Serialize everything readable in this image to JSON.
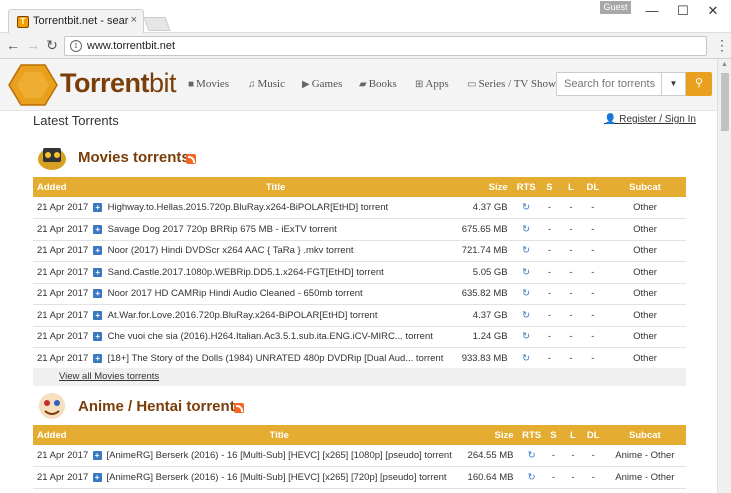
{
  "browser": {
    "tab_title": "Torrentbit.net - search to",
    "tab_close": "×",
    "guest_label": "Guest",
    "minimize": "—",
    "maximize": "☐",
    "close": "✕",
    "url": "www.torrentbit.net"
  },
  "site": {
    "logo_main": "Torrent",
    "logo_bit": "bit",
    "menu": [
      {
        "label": "Movies",
        "icon": "film-icon"
      },
      {
        "label": "Music",
        "icon": "music-icon"
      },
      {
        "label": "Games",
        "icon": "play-icon"
      },
      {
        "label": "Books",
        "icon": "book-icon"
      },
      {
        "label": "Apps",
        "icon": "windows-icon"
      },
      {
        "label": "Series / TV Shows",
        "icon": "tv-icon"
      }
    ],
    "search_placeholder": "Search for torrents",
    "latest": "Latest Torrents",
    "register": "Register / Sign In"
  },
  "columns": [
    "Added",
    "Title",
    "Size",
    "RTS",
    "S",
    "L",
    "DL",
    "Subcat"
  ],
  "movies": {
    "title": "Movies torrents",
    "view_all": "View all Movies torrents",
    "rows": [
      {
        "added": "21 Apr 2017",
        "title": "Highway.to.Hellas.2015.720p.BluRay.x264-BiPOLAR[EtHD] torrent",
        "size": "4.37 GB",
        "s": "-",
        "l": "-",
        "dl": "-",
        "subcat": "Other"
      },
      {
        "added": "21 Apr 2017",
        "title": "Savage Dog 2017 720p BRRip 675 MB - iExTV torrent",
        "size": "675.65 MB",
        "s": "-",
        "l": "-",
        "dl": "-",
        "subcat": "Other"
      },
      {
        "added": "21 Apr 2017",
        "title": "Noor (2017) Hindi DVDScr x264 AAC { TaRa } .mkv torrent",
        "size": "721.74 MB",
        "s": "-",
        "l": "-",
        "dl": "-",
        "subcat": "Other"
      },
      {
        "added": "21 Apr 2017",
        "title": "Sand.Castle.2017.1080p.WEBRip.DD5.1.x264-FGT[EtHD] torrent",
        "size": "5.05 GB",
        "s": "-",
        "l": "-",
        "dl": "-",
        "subcat": "Other"
      },
      {
        "added": "21 Apr 2017",
        "title": "Noor 2017 HD CAMRip Hindi Audio Cleaned - 650mb torrent",
        "size": "635.82 MB",
        "s": "-",
        "l": "-",
        "dl": "-",
        "subcat": "Other"
      },
      {
        "added": "21 Apr 2017",
        "title": "At.War.for.Love.2016.720p.BluRay.x264-BiPOLAR[EtHD] torrent",
        "size": "4.37 GB",
        "s": "-",
        "l": "-",
        "dl": "-",
        "subcat": "Other"
      },
      {
        "added": "21 Apr 2017",
        "title": "Che vuoi che sia (2016).H264.Italian.Ac3.5.1.sub.ita.ENG.iCV-MIRC... torrent",
        "size": "1.24 GB",
        "s": "-",
        "l": "-",
        "dl": "-",
        "subcat": "Other"
      },
      {
        "added": "21 Apr 2017",
        "title": "[18+] The Story of the Dolls (1984) UNRATED 480p DVDRip [Dual Aud... torrent",
        "size": "933.83 MB",
        "s": "-",
        "l": "-",
        "dl": "-",
        "subcat": "Other"
      }
    ]
  },
  "anime": {
    "title": "Anime / Hentai torrents",
    "rows": [
      {
        "added": "21 Apr 2017",
        "title": "[AnimeRG] Berserk (2016) - 16 [Multi-Sub] [HEVC] [x265] [1080p] [pseudo] torrent",
        "size": "264.55 MB",
        "s": "-",
        "l": "-",
        "dl": "-",
        "subcat": "Anime - Other"
      },
      {
        "added": "21 Apr 2017",
        "title": "[AnimeRG] Berserk (2016) - 16 [Multi-Sub] [HEVC] [x265] [720p] [pseudo] torrent",
        "size": "160.64 MB",
        "s": "-",
        "l": "-",
        "dl": "-",
        "subcat": "Anime - Other"
      }
    ]
  }
}
